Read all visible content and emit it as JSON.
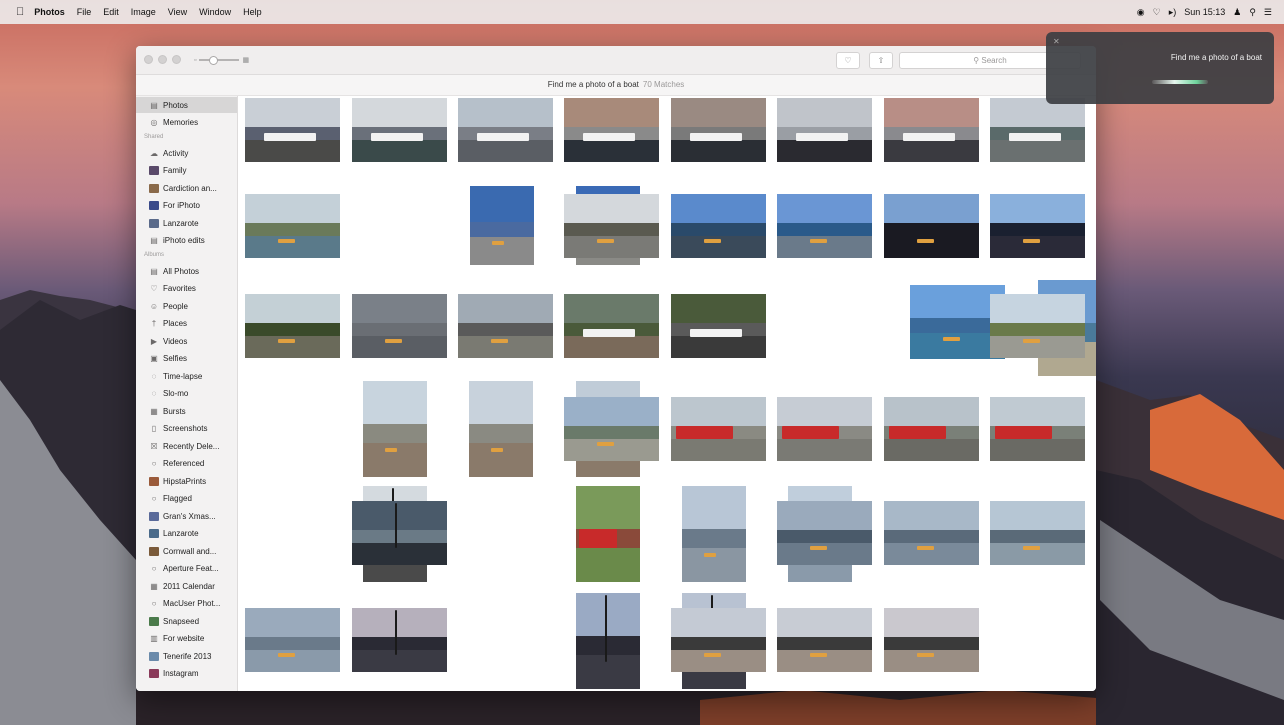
{
  "menubar": {
    "apple_icon": "apple-logo-icon",
    "menus": [
      "Photos",
      "File",
      "Edit",
      "Image",
      "View",
      "Window",
      "Help"
    ],
    "clock": "Sun 15:13",
    "status_icons": [
      "siri-icon",
      "wifi-icon",
      "volume-icon",
      "user-icon",
      "search-icon",
      "list-icon"
    ]
  },
  "window": {
    "search_placeholder": "Search",
    "result_query": "Find me a photo of a boat",
    "result_count": "70 Matches"
  },
  "sidebar": {
    "library": [
      {
        "label": "Photos",
        "icon": "photos-icon",
        "selected": true
      },
      {
        "label": "Memories",
        "icon": "memories-icon"
      }
    ],
    "shared_header": "Shared",
    "shared": [
      {
        "label": "Activity",
        "icon": "cloud-icon"
      },
      {
        "label": "Family",
        "thumb": "#5a4a6a"
      },
      {
        "label": "Cardiction an...",
        "thumb": "#8a6a4a"
      },
      {
        "label": "For iPhoto",
        "thumb": "#3a4a8a"
      },
      {
        "label": "Lanzarote",
        "thumb": "#5a6a8a"
      },
      {
        "label": "iPhoto edits",
        "icon": "album-icon"
      }
    ],
    "albums_header": "Albums",
    "albums": [
      {
        "label": "All Photos",
        "icon": "album-icon"
      },
      {
        "label": "Favorites",
        "icon": "heart-icon"
      },
      {
        "label": "People",
        "icon": "person-icon"
      },
      {
        "label": "Places",
        "icon": "pin-icon"
      },
      {
        "label": "Videos",
        "icon": "video-icon"
      },
      {
        "label": "Selfies",
        "icon": "selfie-icon"
      },
      {
        "label": "Time-lapse",
        "icon": "timelapse-icon"
      },
      {
        "label": "Slo-mo",
        "icon": "slomo-icon"
      },
      {
        "label": "Bursts",
        "icon": "burst-icon"
      },
      {
        "label": "Screenshots",
        "icon": "screenshot-icon"
      },
      {
        "label": "Recently Dele...",
        "icon": "trash-icon"
      },
      {
        "label": "Referenced",
        "icon": "smart-album-icon"
      },
      {
        "label": "HipstaPrints",
        "thumb": "#9a5a3a"
      },
      {
        "label": "Flagged",
        "icon": "smart-album-icon"
      },
      {
        "label": "Gran's Xmas...",
        "thumb": "#5a6a9a"
      },
      {
        "label": "Lanzarote",
        "thumb": "#4a6a8a"
      },
      {
        "label": "Cornwall and...",
        "thumb": "#7a5a3a"
      },
      {
        "label": "Aperture Feat...",
        "icon": "smart-album-icon"
      },
      {
        "label": "2011 Calendar",
        "icon": "calendar-icon"
      },
      {
        "label": "MacUser Phot...",
        "icon": "smart-album-icon"
      },
      {
        "label": "Snapseed",
        "thumb": "#4a7a4a"
      },
      {
        "label": "For website",
        "icon": "folder-icon"
      },
      {
        "label": "Tenerife 2013",
        "thumb": "#6a8aaa"
      },
      {
        "label": "Instagram",
        "thumb": "#8a3a5a"
      }
    ]
  },
  "photos": [
    {
      "scene": "harbour",
      "sky": "#c9cfd6",
      "mid": "#5a6070",
      "gnd": "#4a4a48"
    },
    {
      "scene": "harbour",
      "sky": "#d4d8dc",
      "mid": "#6a707a",
      "gnd": "#3a4a4a"
    },
    {
      "scene": "harbour",
      "sky": "#b6c0ca",
      "mid": "#7a7e86",
      "gnd": "#5a5e64"
    },
    {
      "scene": "harbour",
      "sky": "#a88a7a",
      "mid": "#8a8a8a",
      "gnd": "#2a3038"
    },
    {
      "scene": "harbour",
      "sky": "#9a8a82",
      "mid": "#7a7a7a",
      "gnd": "#2a2e34"
    },
    {
      "scene": "harbour",
      "sky": "#c0c4ca",
      "mid": "#9a9ea4",
      "gnd": "#2a2a30"
    },
    {
      "scene": "harbour",
      "sky": "#b88e86",
      "mid": "#8a8a8e",
      "gnd": "#3a3a40"
    },
    {
      "scene": "harbour",
      "sky": "#c4cad2",
      "mid": "#5a6a6a",
      "gnd": "#6a7070"
    },
    {
      "scene": "beach",
      "sky": "#c4d0d8",
      "mid": "#6a7a5a",
      "gnd": "#5a7a8a"
    },
    {
      "scene": "blue",
      "sky": "#3a6ab0",
      "mid": "#4a6aa0",
      "gnd": "#8a8a8a"
    },
    {
      "scene": "blue",
      "sky": "#3a6ab6",
      "mid": "#4a6a9a",
      "gnd": "#8a8a86"
    },
    {
      "scene": "beach",
      "sky": "#d4d8dc",
      "mid": "#5a5a50",
      "gnd": "#7a7a76"
    },
    {
      "scene": "beach",
      "sky": "#5a8acc",
      "mid": "#2a4a6a",
      "gnd": "#3a4a5a"
    },
    {
      "scene": "beach",
      "sky": "#6a96d4",
      "mid": "#2a5a8a",
      "gnd": "#6a7a8a"
    },
    {
      "scene": "sunset",
      "sky": "#7aa0d0",
      "mid": "#1a1a22",
      "gnd": "#1a1a22"
    },
    {
      "scene": "sunset",
      "sky": "#8ab0dc",
      "mid": "#1a2030",
      "gnd": "#2a2a38"
    },
    {
      "scene": "beach",
      "sky": "#c4d0d6",
      "mid": "#3a4a2a",
      "gnd": "#6a6a5a"
    },
    {
      "scene": "beach",
      "sky": "#7a8088",
      "mid": "#6a6e74",
      "gnd": "#5a5e64"
    },
    {
      "scene": "beach",
      "sky": "#a0aab4",
      "mid": "#5a5a5a",
      "gnd": "#7a7a72"
    },
    {
      "scene": "harbour",
      "sky": "#6a7a6a",
      "mid": "#4a5a3a",
      "gnd": "#7a6a5a"
    },
    {
      "scene": "harbour",
      "sky": "#4a5a3a",
      "mid": "#5a5a5a",
      "gnd": "#3a3a3a"
    },
    {
      "scene": "blue",
      "sky": "#6aa0dc",
      "mid": "#3a6a9a",
      "gnd": "#3a7aa0"
    },
    {
      "scene": "blue",
      "sky": "#6a9ad0",
      "mid": "#4a7a9a",
      "gnd": "#b0a890"
    },
    {
      "scene": "beach",
      "sky": "#c6d4e0",
      "mid": "#6a7a4a",
      "gnd": "#9a9a92"
    },
    {
      "scene": "beach",
      "sky": "#c8d4de",
      "mid": "#8a8a80",
      "gnd": "#8a7a6a"
    },
    {
      "scene": "beach",
      "sky": "#c8d2dc",
      "mid": "#8a8a82",
      "gnd": "#8a7a6a"
    },
    {
      "scene": "beach",
      "sky": "#c0ccd8",
      "mid": "#8a8a82",
      "gnd": "#8a7a6a"
    },
    {
      "scene": "beach",
      "sky": "#9ab0c8",
      "mid": "#6a7a6a",
      "gnd": "#9a9a90"
    },
    {
      "scene": "redboat",
      "sky": "#bcc6ce",
      "mid": "#8a8a82",
      "gnd": "#7a7a72"
    },
    {
      "scene": "redboat",
      "sky": "#c6ccd4",
      "mid": "#8a8a84",
      "gnd": "#7a7a74"
    },
    {
      "scene": "redboat",
      "sky": "#b8c2ca",
      "mid": "#7a8078",
      "gnd": "#6a6a64"
    },
    {
      "scene": "redboat",
      "sky": "#c0cad2",
      "mid": "#7a8078",
      "gnd": "#6a6a64"
    },
    {
      "scene": "masts",
      "sky": "#d4dadf",
      "mid": "#3a3a3a",
      "gnd": "#4a4a4a"
    },
    {
      "scene": "masts",
      "sky": "#4a5a6a",
      "mid": "#6a7a86",
      "gnd": "#2a3038"
    },
    {
      "scene": "redboat",
      "sky": "#7a9a5a",
      "mid": "#8a4a3a",
      "gnd": "#6a8a4a"
    },
    {
      "scene": "dusk",
      "sky": "#b8c6d6",
      "mid": "#6a7a8a",
      "gnd": "#8a96a2"
    },
    {
      "scene": "dusk",
      "sky": "#c0cedc",
      "mid": "#6a7a8a",
      "gnd": "#8a9aaa"
    },
    {
      "scene": "dusk",
      "sky": "#9aaabc",
      "mid": "#4a5a6a",
      "gnd": "#6a7a8a"
    },
    {
      "scene": "dusk",
      "sky": "#a8b8c8",
      "mid": "#5a6a7a",
      "gnd": "#7a8a9a"
    },
    {
      "scene": "dusk",
      "sky": "#b6c6d4",
      "mid": "#5a6a78",
      "gnd": "#8a9aa6"
    },
    {
      "scene": "dusk",
      "sky": "#9aaabc",
      "mid": "#6a7a8a",
      "gnd": "#8a9aaa"
    },
    {
      "scene": "masts",
      "sky": "#b6b0bc",
      "mid": "#2a2a34",
      "gnd": "#3a3a44"
    },
    {
      "scene": "masts",
      "sky": "#9aaac4",
      "mid": "#2a2a34",
      "gnd": "#3a3a44"
    },
    {
      "scene": "masts",
      "sky": "#b8c2d2",
      "mid": "#2a2a34",
      "gnd": "#3a3a44"
    },
    {
      "scene": "dusk",
      "sky": "#c4cad4",
      "mid": "#3a3a3a",
      "gnd": "#9a8e84"
    },
    {
      "scene": "dusk",
      "sky": "#c8ccd4",
      "mid": "#3a3a3a",
      "gnd": "#9a8e84"
    },
    {
      "scene": "dusk",
      "sky": "#cac8ce",
      "mid": "#3a3a3a",
      "gnd": "#9a8e84"
    },
    {
      "scene": "dusk",
      "sky": "#c8c6ce",
      "mid": "#3a3a3a",
      "gnd": "#8a7e76"
    }
  ],
  "siri": {
    "query": "Find me a photo of a boat"
  }
}
